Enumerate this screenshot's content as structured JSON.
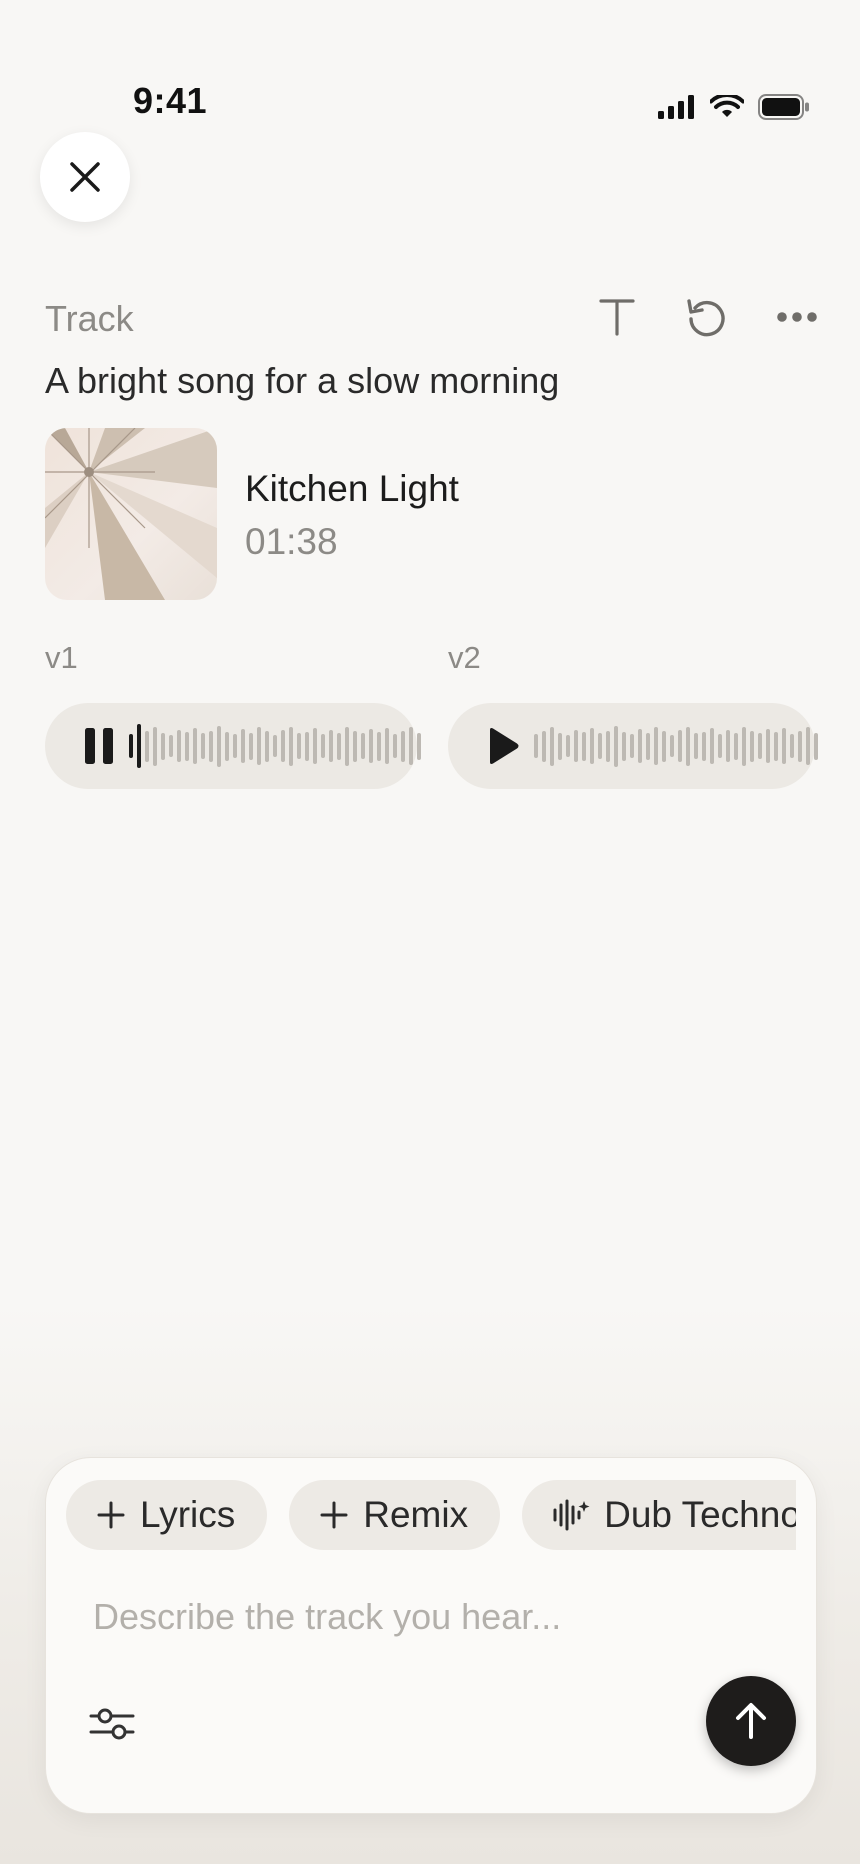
{
  "status_bar": {
    "time": "9:41"
  },
  "header": {
    "section_label": "Track",
    "prompt": "A bright song for a slow morning"
  },
  "song": {
    "title": "Kitchen Light",
    "duration": "01:38"
  },
  "versions": [
    {
      "label": "v1",
      "state": "playing",
      "progress": 0.04
    },
    {
      "label": "v2",
      "state": "paused",
      "progress": 0
    }
  ],
  "composer": {
    "chips": [
      {
        "label": "Lyrics",
        "icon": "plus-icon"
      },
      {
        "label": "Remix",
        "icon": "plus-icon"
      },
      {
        "label": "Dub Techno",
        "icon": "waveform-sparkle-icon"
      }
    ],
    "placeholder": "Describe the track you hear..."
  },
  "colors": {
    "background": "#f8f7f5",
    "accent_dark": "#1e1c1b",
    "muted_text": "#8c8a86",
    "player_bg": "#ece9e4"
  }
}
